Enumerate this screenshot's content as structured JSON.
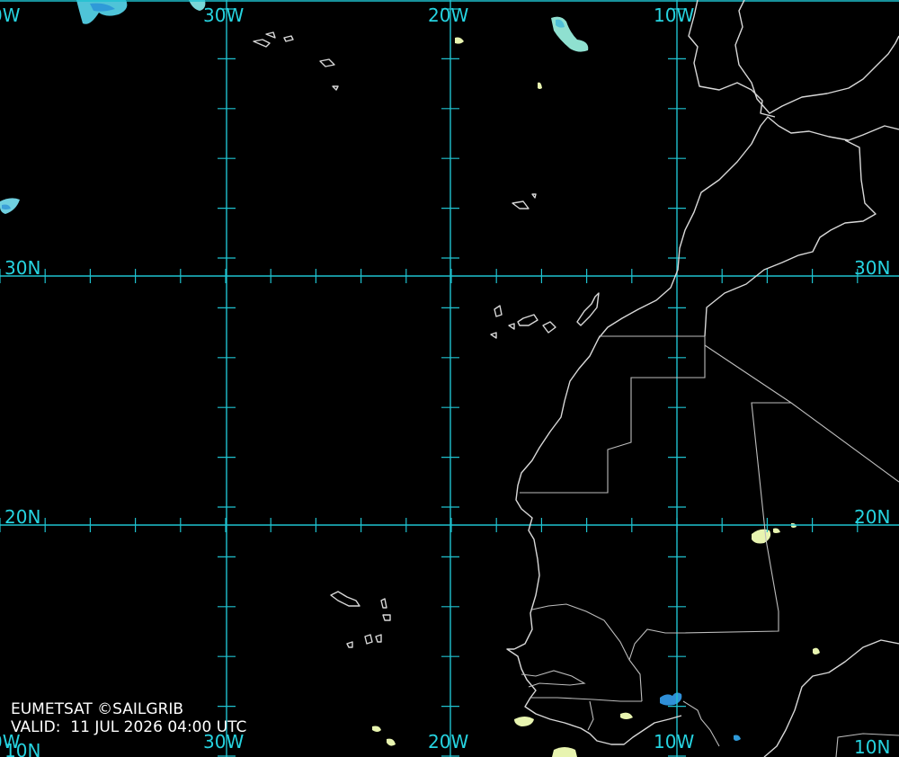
{
  "map": {
    "lon_labels": [
      "0W",
      "30W",
      "20W",
      "10W"
    ],
    "lat_labels": [
      "30N",
      "20N",
      "10N"
    ],
    "bottom_lon_labels": [
      "0W",
      "30W",
      "20W",
      "10W",
      "10N"
    ],
    "bottom_lat_label": "10N"
  },
  "caption": {
    "credit": "EUMETSAT ©SAILGRIB",
    "valid": "VALID:  11 JUL 2026 04:00 UTC"
  },
  "colors": {
    "grid": "#1fc2cf",
    "coast": "#d8d8d8",
    "cloud_cold": "#2f8fd8",
    "cloud_cyan": "#5fd0e0",
    "cloud_warm": "#e8f4b0"
  }
}
